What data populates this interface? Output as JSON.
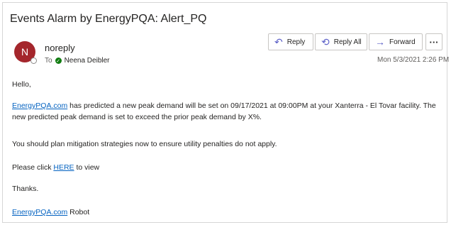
{
  "email": {
    "subject": "Events Alarm by EnergyPQA: Alert_PQ",
    "sender": {
      "name": "noreply",
      "initial": "N"
    },
    "to_label": "To",
    "recipient": "Neena Deibler",
    "timestamp": "Mon 5/3/2021 2:26 PM"
  },
  "actions": {
    "reply": "Reply",
    "reply_all": "Reply All",
    "forward": "Forward",
    "more": "···"
  },
  "body": {
    "greeting": "Hello,",
    "main_link": "EnergyPQA.com",
    "main_text": " has predicted a new peak demand will be set on 09/17/2021 at 09:00PM at your Xanterra - El Tovar facility. The new predicted peak demand is set to exceed the prior peak demand by X%.",
    "plan": "You should plan mitigation strategies now to ensure utility penalties do not apply.",
    "click_prefix": "Please click ",
    "click_link": "HERE",
    "click_suffix": " to view",
    "thanks": "Thanks.",
    "sig_link": "EnergyPQA.com",
    "sig_suffix": " Robot"
  },
  "colors": {
    "avatar": "#a4262c",
    "link": "#0563c1",
    "action_icon": "#5b5fc7",
    "presence_check": "#107c10"
  },
  "icons": {
    "reply": "reply-icon",
    "reply_all": "reply-all-icon",
    "forward": "forward-arrow-icon",
    "more": "more-options-icon",
    "check": "check-circle-icon"
  }
}
